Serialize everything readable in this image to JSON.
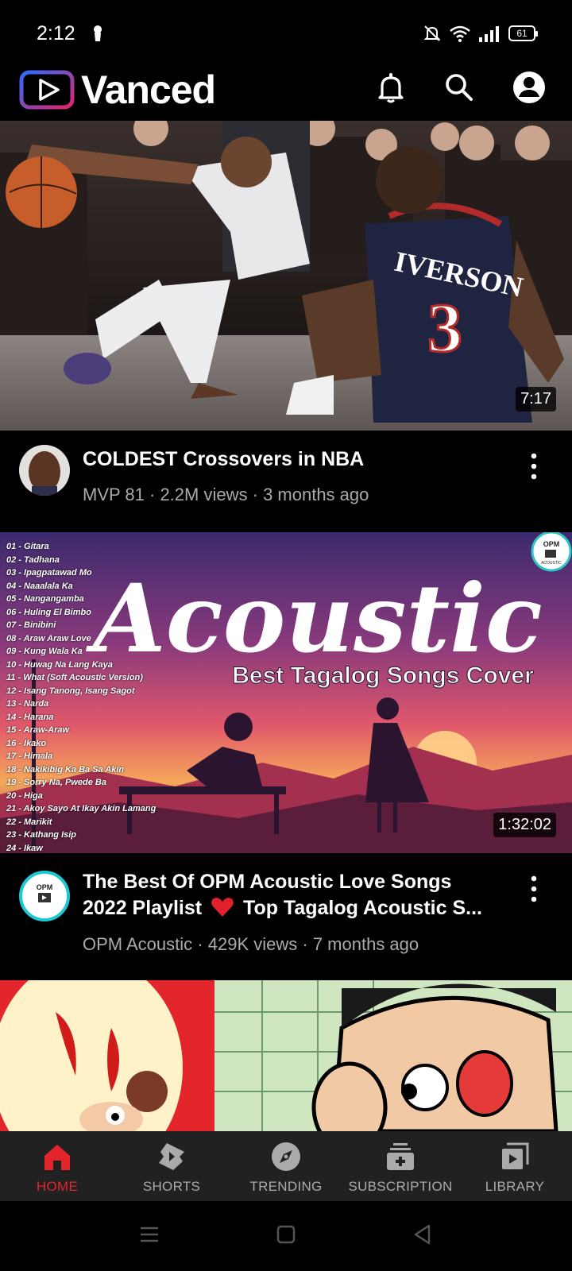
{
  "status_bar": {
    "time": "2:12",
    "battery": "61"
  },
  "header": {
    "app_name": "Vanced",
    "icons": [
      "bell-icon",
      "search-icon",
      "account-icon"
    ]
  },
  "videos": [
    {
      "duration": "7:17",
      "title": "COLDEST Crossovers in NBA",
      "channel": "MVP 81",
      "views": "2.2M views",
      "age": "3 months ago",
      "jersey_name": "IVERSON",
      "jersey_number": "3"
    },
    {
      "duration": "1:32:02",
      "title_line1": "The Best Of OPM Acoustic Love Songs",
      "title_line2_pre": "2022 Playlist",
      "title_line2_post": "Top Tagalog Acoustic S...",
      "channel": "OPM Acoustic",
      "views": "429K views",
      "age": "7 months ago",
      "thumb_title": "Acoustic",
      "thumb_subtitle": "Best Tagalog Songs Cover",
      "badge": "OPM",
      "badge_sub": "ACOUSTIC",
      "tracks": [
        "01 - Gitara",
        "02 - Tadhana",
        "03 - Ipagpatawad Mo",
        "04 - Naaalala Ka",
        "05 - Nangangamba",
        "06 - Huling El Bimbo",
        "07 - Binibini",
        "08 - Araw Araw Love",
        "09 - Kung Wala Ka",
        "10 - Huwag Na Lang Kaya",
        "11 - What (Soft Acoustic Version)",
        "12 - Isang Tanong, Isang Sagot",
        "13 - Narda",
        "14 - Harana",
        "15 - Araw-Araw",
        "16 - Ikako",
        "17 - Himala",
        "18 - Nakikibig Ka Ba Sa Akin",
        "19 - Sorry Na, Pwede Ba",
        "20 - Higa",
        "21 - Akoy Sayo At Ikay Akin Lamang",
        "22 - Marikit",
        "23 - Kathang Isip",
        "24 - Ikaw"
      ]
    }
  ],
  "bottom_nav": [
    {
      "label": "HOME",
      "icon": "home-icon",
      "active": true
    },
    {
      "label": "SHORTS",
      "icon": "shorts-icon",
      "active": false
    },
    {
      "label": "TRENDING",
      "icon": "trending-icon",
      "active": false
    },
    {
      "label": "SUBSCRIPTION",
      "icon": "subscription-icon",
      "active": false
    },
    {
      "label": "LIBRARY",
      "icon": "library-icon",
      "active": false
    }
  ],
  "colors": {
    "accent": "#e5252c",
    "nav_bg": "#212121",
    "meta_text": "#aaaaaa"
  }
}
